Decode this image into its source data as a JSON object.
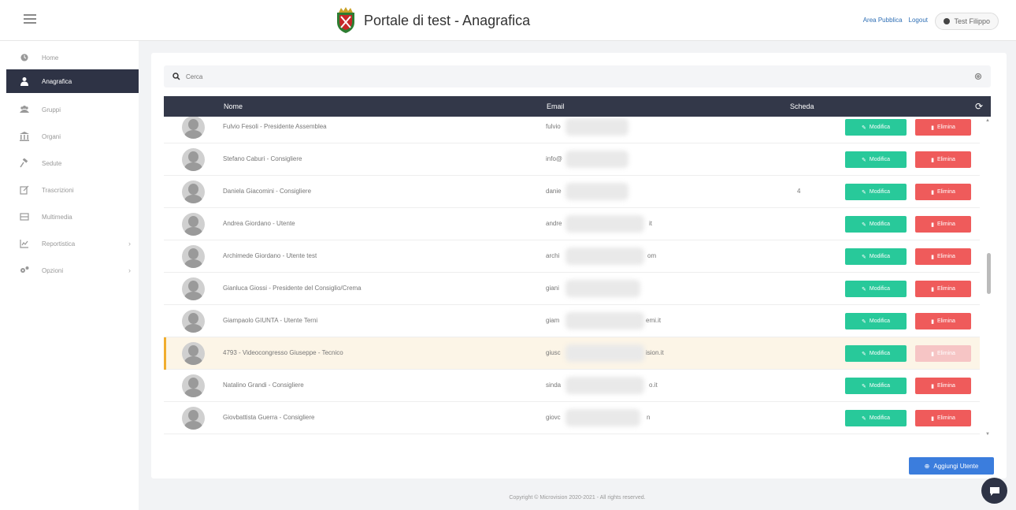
{
  "header": {
    "title": "Portale di test - Anagrafica",
    "links": [
      "Area Pubblica",
      "Logout"
    ],
    "user": "Test Filippo"
  },
  "sidebar": {
    "items": [
      {
        "label": "Home",
        "icon": "dashboard-icon",
        "active": false,
        "has_submenu": false
      },
      {
        "label": "Anagrafica",
        "icon": "user-icon",
        "active": true,
        "has_submenu": false
      },
      {
        "label": "Gruppi",
        "icon": "users-icon",
        "active": false,
        "has_submenu": false
      },
      {
        "label": "Organi",
        "icon": "institution-icon",
        "active": false,
        "has_submenu": false
      },
      {
        "label": "Sedute",
        "icon": "gavel-icon",
        "active": false,
        "has_submenu": false
      },
      {
        "label": "Trascrizioni",
        "icon": "edit-icon",
        "active": false,
        "has_submenu": false
      },
      {
        "label": "Multimedia",
        "icon": "media-icon",
        "active": false,
        "has_submenu": false
      },
      {
        "label": "Reportistica",
        "icon": "chart-icon",
        "active": false,
        "has_submenu": true
      },
      {
        "label": "Opzioni",
        "icon": "cogs-icon",
        "active": false,
        "has_submenu": true
      }
    ]
  },
  "search": {
    "placeholder": "Cerca"
  },
  "table": {
    "headers": {
      "name": "Nome",
      "email": "Email",
      "scheda": "Scheda"
    },
    "edit_label": "Modifica",
    "delete_label": "Elimina",
    "rows": [
      {
        "name": "Fulvio Fesoli - Presidente Assemblea",
        "email_start": "fulvio",
        "email_end": "",
        "scheda": "",
        "highlighted": false,
        "delete_disabled": false
      },
      {
        "name": "Stefano Caburi - Consigliere",
        "email_start": "info@",
        "email_end": "",
        "scheda": "",
        "highlighted": false,
        "delete_disabled": false
      },
      {
        "name": "Daniela Giacomini - Consigliere",
        "email_start": "danie",
        "email_end": "",
        "scheda": "4",
        "highlighted": false,
        "delete_disabled": false
      },
      {
        "name": "Andrea Giordano - Utente",
        "email_start": "andre",
        "email_end": "it",
        "scheda": "",
        "highlighted": false,
        "delete_disabled": false
      },
      {
        "name": "Archimede Giordano - Utente test",
        "email_start": "archi",
        "email_end": "om",
        "scheda": "",
        "highlighted": false,
        "delete_disabled": false
      },
      {
        "name": "Gianluca Giossi - Presidente del Consiglio/Crema",
        "email_start": "giani",
        "email_end": "",
        "scheda": "",
        "highlighted": false,
        "delete_disabled": false
      },
      {
        "name": "Giampaolo GIUNTA - Utente Terni",
        "email_start": "giam",
        "email_end": "emi.it",
        "scheda": "",
        "highlighted": false,
        "delete_disabled": false
      },
      {
        "name": "4793 - Videocongresso Giuseppe - Tecnico",
        "email_start": "giusc",
        "email_end": "ision.it",
        "scheda": "",
        "highlighted": true,
        "delete_disabled": true
      },
      {
        "name": "Natalino Grandi - Consigliere",
        "email_start": "sinda",
        "email_end": "o.it",
        "scheda": "",
        "highlighted": false,
        "delete_disabled": false
      },
      {
        "name": "Giovbattista Guerra - Consigliere",
        "email_start": "giovc",
        "email_end": "n",
        "scheda": "",
        "highlighted": false,
        "delete_disabled": false
      }
    ]
  },
  "add_button": {
    "label": "Aggiungi Utente"
  },
  "footer": {
    "text": "Copyright © Microvision 2020-2021 - All rights reserved."
  },
  "colors": {
    "sidebar_active": "#2e3345",
    "edit": "#28c99a",
    "delete": "#ef5b5b",
    "primary": "#3b7ddd",
    "highlight_row": "#fcf5e7",
    "highlight_stripe": "#f0ad2e"
  }
}
